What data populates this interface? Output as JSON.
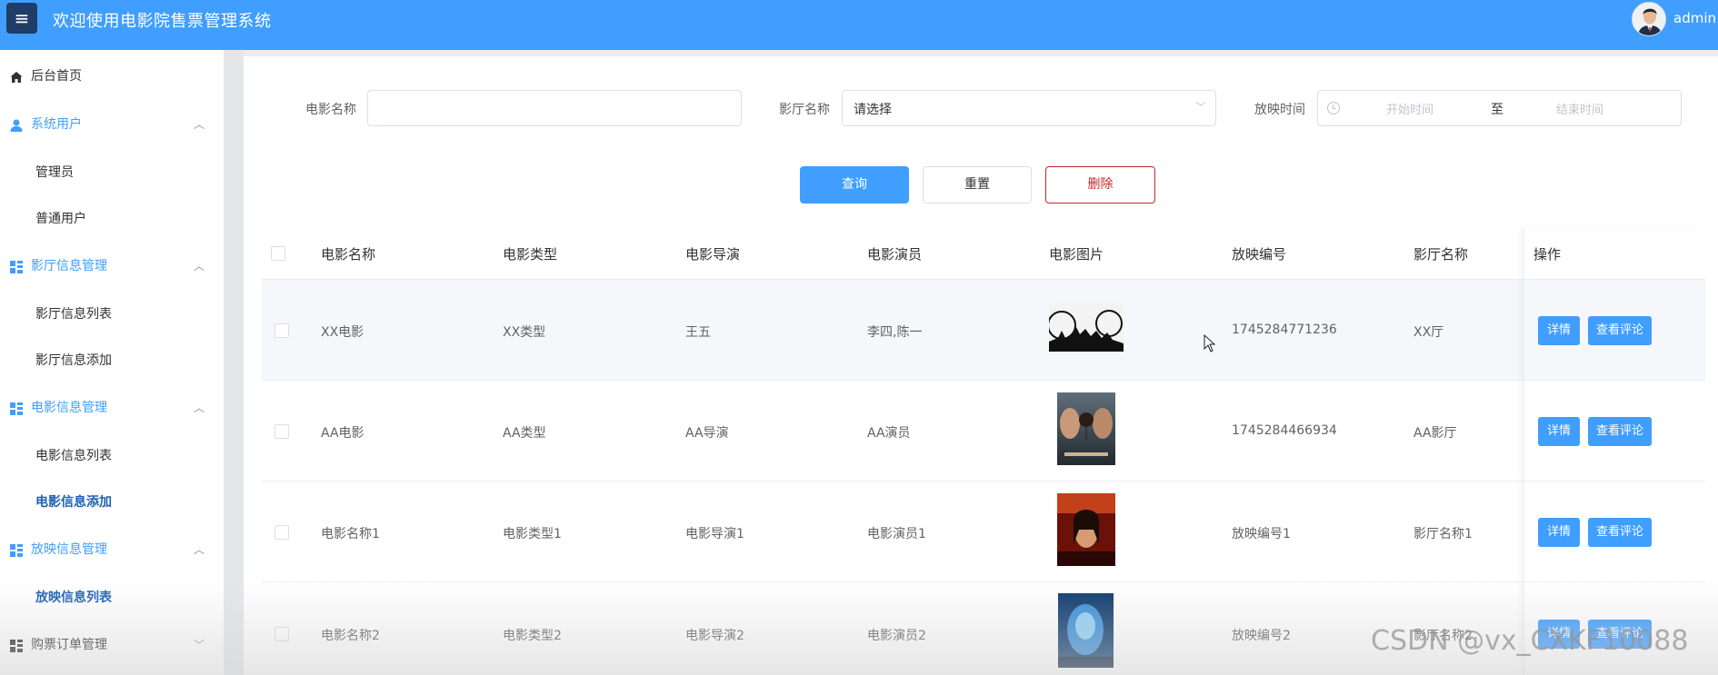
{
  "header": {
    "title": "欢迎使用电影院售票管理系统",
    "user": "admin",
    "menu_icon": "≡"
  },
  "sidebar": {
    "home": "后台首页",
    "groups": [
      {
        "label": "系统用户",
        "items": [
          "管理员",
          "普通用户"
        ]
      },
      {
        "label": "影厅信息管理",
        "items": [
          "影厅信息列表",
          "影厅信息添加"
        ]
      },
      {
        "label": "电影信息管理",
        "items": [
          "电影信息列表",
          "电影信息添加"
        ]
      },
      {
        "label": "放映信息管理",
        "items": [
          "放映信息列表"
        ]
      },
      {
        "label": "购票订单管理",
        "items": []
      }
    ],
    "active_item": "电影信息添加"
  },
  "filters": {
    "movie_name_label": "电影名称",
    "movie_name_value": "",
    "hall_label": "影厅名称",
    "hall_value": "请选择",
    "time_label": "放映时间",
    "start_placeholder": "开始时间",
    "range_sep": "至",
    "end_placeholder": "结束时间"
  },
  "buttons": {
    "search": "查询",
    "reset": "重置",
    "delete": "删除"
  },
  "table": {
    "headers": [
      "电影名称",
      "电影类型",
      "电影导演",
      "电影演员",
      "电影图片",
      "放映编号",
      "影厅名称",
      "操作"
    ],
    "rows": [
      {
        "name": "XX电影",
        "type": "XX类型",
        "director": "王五",
        "actors": "李四,陈一",
        "screening_no": "1745284771236",
        "hall": "XX厅"
      },
      {
        "name": "AA电影",
        "type": "AA类型",
        "director": "AA导演",
        "actors": "AA演员",
        "screening_no": "1745284466934",
        "hall": "AA影厅"
      },
      {
        "name": "电影名称1",
        "type": "电影类型1",
        "director": "电影导演1",
        "actors": "电影演员1",
        "screening_no": "放映编号1",
        "hall": "影厅名称1"
      },
      {
        "name": "电影名称2",
        "type": "电影类型2",
        "director": "电影导演2",
        "actors": "电影演员2",
        "screening_no": "放映编号2",
        "hall": "影厅名称2"
      }
    ],
    "row_actions": {
      "detail": "详情",
      "comments": "查看评论"
    }
  },
  "watermark": "CSDN @vx_CXKF10088",
  "colors": {
    "primary": "#409eff",
    "danger": "#c62828",
    "sidebar_active": "#1f5fb4"
  },
  "icons": {
    "home": "home-icon",
    "user": "user-icon",
    "grid": "grid-icon",
    "chevron_up": "chevron-up-icon",
    "chevron_down": "chevron-down-icon",
    "clock": "clock-icon"
  }
}
